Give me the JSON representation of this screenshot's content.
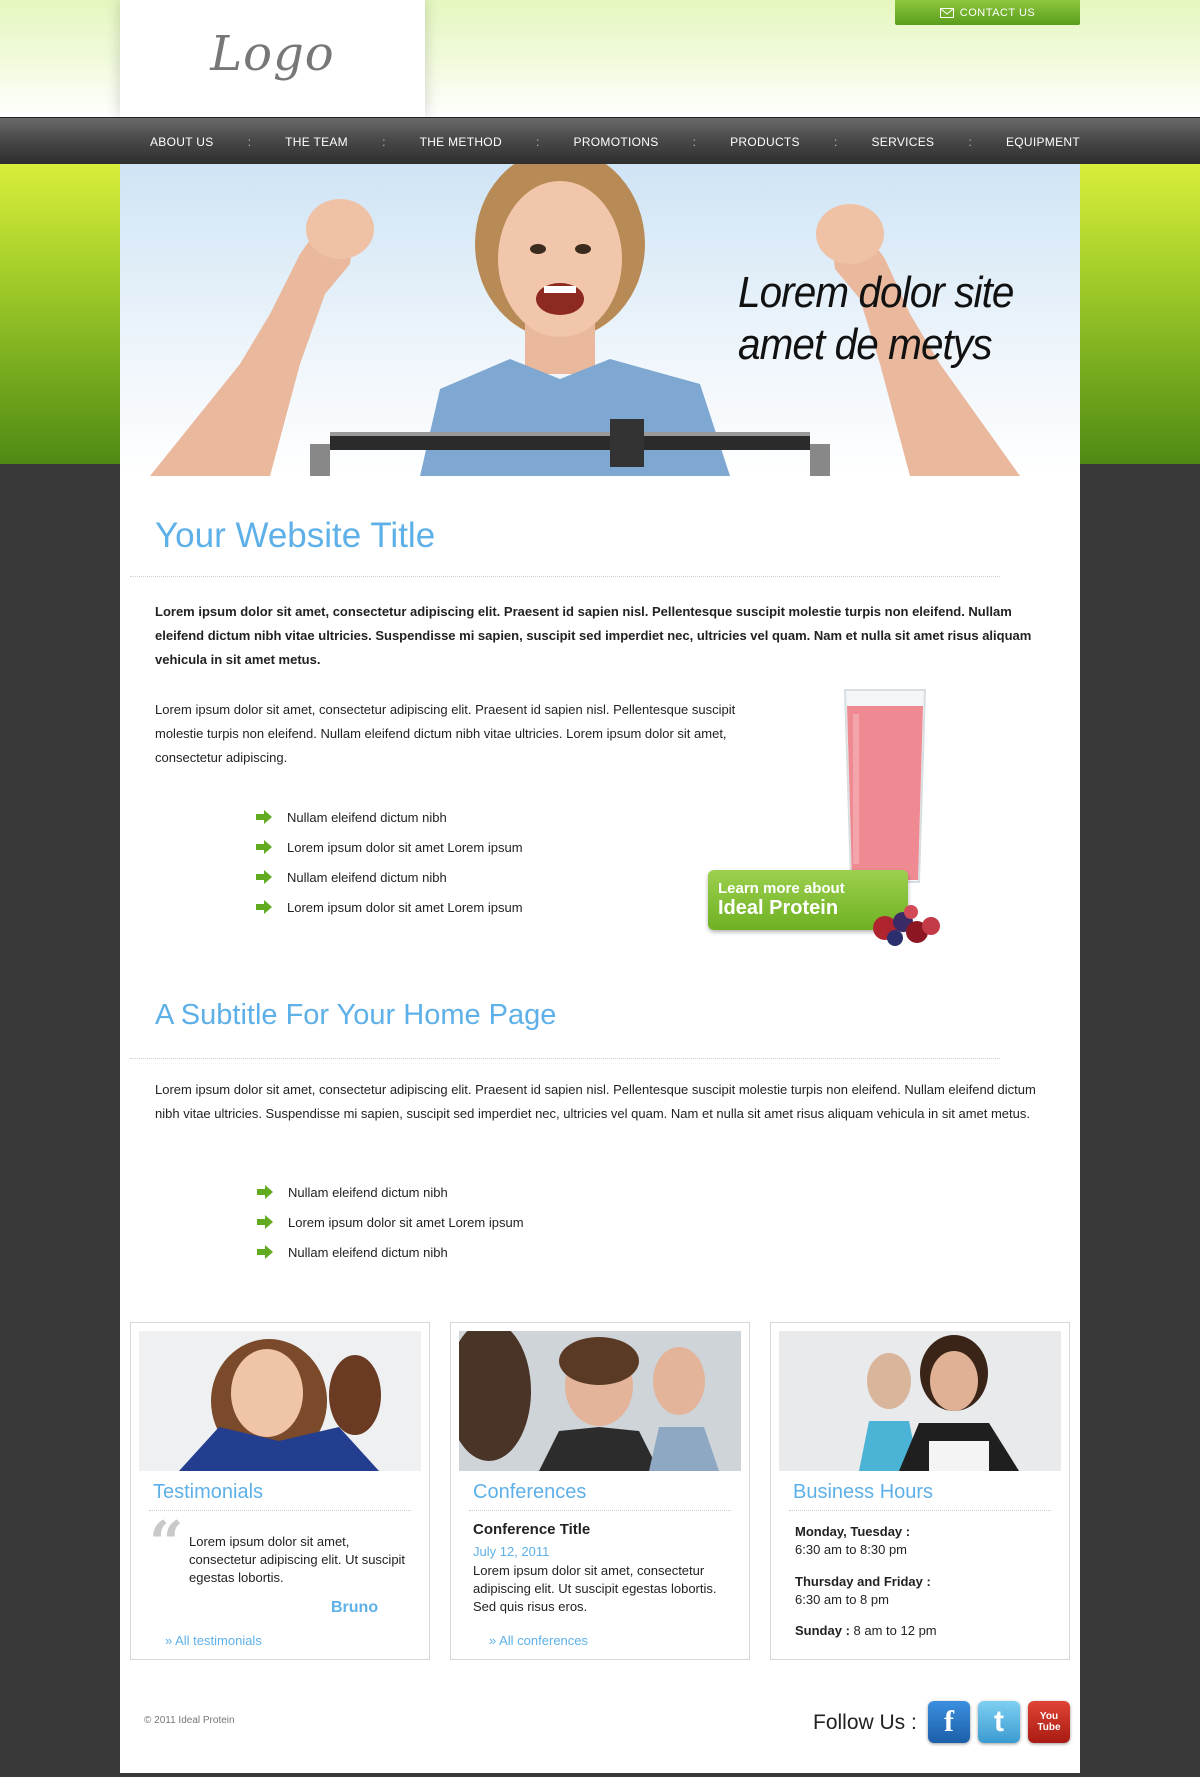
{
  "header": {
    "logo_text": "Logo",
    "contact_label": "CONTACT US"
  },
  "nav": {
    "items": [
      "ABOUT US",
      "THE TEAM",
      "THE METHOD",
      "PROMOTIONS",
      "PRODUCTS",
      "SERVICES",
      "EQUIPMENT"
    ],
    "separator": ":"
  },
  "hero": {
    "headline_line1": "Lorem dolor site",
    "headline_line2": "amet de metys"
  },
  "main": {
    "title": "Your Website Title",
    "intro_bold": "Lorem ipsum dolor sit amet, consectetur adipiscing elit. Praesent id sapien nisl. Pellentesque suscipit molestie turpis non eleifend. Nullam eleifend dictum nibh vitae ultricies. Suspendisse mi sapien, suscipit sed imperdiet nec, ultricies vel quam. Nam et nulla sit amet risus aliquam vehicula in sit amet metus.",
    "intro_para": "Lorem ipsum dolor sit amet, consectetur adipiscing elit. Praesent id sapien nisl. Pellentesque suscipit molestie turpis non eleifend. Nullam eleifend dictum nibh vitae ultricies. Lorem ipsum dolor sit amet, consectetur adipiscing.",
    "bullets_1": [
      "Nullam eleifend dictum nibh",
      "Lorem ipsum dolor sit amet Lorem ipsum",
      "Nullam eleifend dictum nibh",
      "Lorem ipsum dolor sit amet Lorem ipsum"
    ],
    "promo_line1": "Learn more about",
    "promo_line2": "Ideal Protein",
    "subtitle": "A Subtitle For Your Home Page",
    "sub_para": "Lorem ipsum dolor sit amet, consectetur adipiscing elit. Praesent id sapien nisl. Pellentesque suscipit molestie turpis non eleifend. Nullam eleifend dictum nibh vitae ultricies. Suspendisse mi sapien, suscipit sed imperdiet nec, ultricies vel quam. Nam et nulla sit amet risus aliquam vehicula in sit amet metus.",
    "bullets_2": [
      "Nullam eleifend dictum nibh",
      "Lorem ipsum dolor sit amet Lorem ipsum",
      "Nullam eleifend dictum nibh"
    ]
  },
  "boxes": {
    "testimonials": {
      "title": "Testimonials",
      "quote": "Lorem ipsum dolor sit amet, consectetur adipiscing elit. Ut suscipit egestas lobortis.",
      "author": "Bruno",
      "link": "» All testimonials"
    },
    "conferences": {
      "title": "Conferences",
      "conf_title": "Conference Title",
      "date": "July 12, 2011",
      "text": "Lorem ipsum dolor sit amet, consectetur adipiscing elit. Ut suscipit egestas lobortis. Sed quis risus eros.",
      "link": "» All conferences"
    },
    "hours": {
      "title": "Business Hours",
      "rows": [
        {
          "label": "Monday, Tuesday :",
          "value": "6:30 am to 8:30 pm"
        },
        {
          "label": "Thursday and Friday :",
          "value": "6:30 am to 8 pm"
        },
        {
          "label": "Sunday :",
          "value": "8 am to 12 pm"
        }
      ]
    }
  },
  "footer": {
    "copyright": "© 2011 Ideal Protein",
    "follow_label": "Follow Us :",
    "social": [
      {
        "name": "facebook",
        "glyph": "f",
        "color": "#1f73c2"
      },
      {
        "name": "twitter",
        "glyph": "t",
        "color": "#4aa8d8"
      },
      {
        "name": "youtube",
        "glyph": "You Tube",
        "color": "#c92a1f"
      }
    ]
  },
  "colors": {
    "accent_blue": "#5eb0e8",
    "nav_dark": "#3a3a3a",
    "green": "#6fb123",
    "page_bg": "#393939"
  }
}
